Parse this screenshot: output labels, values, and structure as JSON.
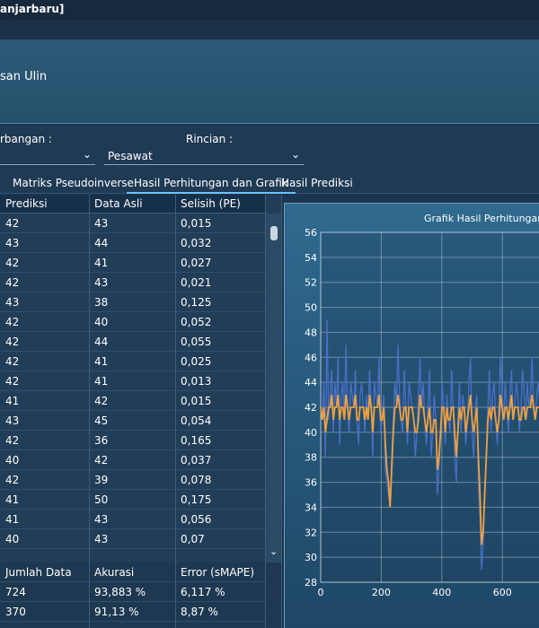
{
  "window": {
    "title": "anjarbaru]"
  },
  "header": {
    "title": "san Ulin"
  },
  "filters": {
    "left_label": "rbangan :",
    "right_label": "Rincian :",
    "right_value": "Pesawat"
  },
  "tabs": [
    "Matriks Pseudoinverse",
    "Hasil Perhitungan dan Grafik",
    "Hasil Prediksi"
  ],
  "grid": {
    "columns": [
      "Prediksi",
      "Data Asli",
      "Selisih (PE)"
    ],
    "rows": [
      [
        "42",
        "43",
        "0,015"
      ],
      [
        "43",
        "44",
        "0,032"
      ],
      [
        "42",
        "41",
        "0,027"
      ],
      [
        "42",
        "43",
        "0,021"
      ],
      [
        "43",
        "38",
        "0,125"
      ],
      [
        "42",
        "40",
        "0,052"
      ],
      [
        "42",
        "44",
        "0,055"
      ],
      [
        "42",
        "41",
        "0,025"
      ],
      [
        "42",
        "41",
        "0,013"
      ],
      [
        "41",
        "42",
        "0,015"
      ],
      [
        "43",
        "45",
        "0,054"
      ],
      [
        "42",
        "36",
        "0,165"
      ],
      [
        "40",
        "42",
        "0,037"
      ],
      [
        "42",
        "39",
        "0,078"
      ],
      [
        "41",
        "50",
        "0,175"
      ],
      [
        "41",
        "43",
        "0,056"
      ],
      [
        "40",
        "43",
        "0,07"
      ]
    ]
  },
  "summary": {
    "columns": [
      "Jumlah Data",
      "Akurasi",
      "Error (sMAPE)"
    ],
    "rows": [
      [
        "724",
        "93,883 %",
        "6,117 %"
      ],
      [
        "370",
        "91,13 %",
        "8,87 %"
      ]
    ]
  },
  "chart_data": {
    "type": "line",
    "title": "Grafik Hasil Perhitungan",
    "xlabel": "",
    "ylabel": "",
    "xlim": [
      0,
      724
    ],
    "ylim": [
      28,
      56
    ],
    "x_ticks": [
      0,
      200,
      400,
      600
    ],
    "y_ticks": [
      28,
      30,
      32,
      34,
      36,
      38,
      40,
      42,
      44,
      46,
      48,
      50,
      52,
      54,
      56
    ],
    "grid": true,
    "colors": {
      "actual": "#4a6fc7",
      "predicted": "#f0a040"
    },
    "series": [
      {
        "values": [
          42,
          41,
          44,
          38,
          49,
          41,
          43,
          45,
          40,
          44,
          42,
          46,
          39,
          43,
          44,
          41,
          47,
          42,
          40,
          44,
          43,
          42,
          45,
          41,
          39,
          43,
          44,
          42,
          40,
          43,
          41,
          45,
          42,
          38,
          44,
          43,
          42,
          46,
          40,
          41,
          43,
          37,
          36,
          35,
          34,
          38,
          41,
          44,
          42,
          47,
          43,
          41,
          40,
          45,
          42,
          39,
          44,
          43,
          42,
          41,
          38,
          40,
          43,
          46,
          42,
          44,
          41,
          39,
          42,
          45,
          38,
          40,
          43,
          41,
          35,
          37,
          40,
          44,
          42,
          39,
          43,
          41,
          40,
          45,
          42,
          38,
          36,
          41,
          44,
          40,
          43,
          42,
          39,
          41,
          44,
          46,
          40,
          38,
          42,
          43,
          36,
          33,
          29,
          31,
          35,
          38,
          42,
          45,
          40,
          43,
          44,
          41,
          39,
          42,
          46,
          43,
          41,
          44,
          42,
          40,
          43,
          45,
          41,
          42,
          44,
          43,
          40,
          42,
          45,
          43,
          41,
          44,
          42,
          43,
          46,
          42,
          41,
          43,
          44,
          42
        ]
      },
      {
        "values": [
          42,
          41,
          42,
          40,
          41,
          42,
          42,
          43,
          41,
          42,
          42,
          43,
          41,
          42,
          42,
          41,
          43,
          42,
          41,
          42,
          42,
          42,
          43,
          41,
          41,
          42,
          42,
          42,
          41,
          42,
          41,
          43,
          42,
          40,
          42,
          42,
          42,
          43,
          41,
          41,
          42,
          39,
          37,
          36,
          34,
          37,
          40,
          42,
          42,
          43,
          42,
          41,
          41,
          42,
          42,
          40,
          42,
          42,
          42,
          41,
          40,
          40,
          41,
          43,
          42,
          42,
          41,
          40,
          41,
          42,
          40,
          40,
          41,
          41,
          37,
          38,
          40,
          42,
          42,
          40,
          42,
          41,
          41,
          42,
          42,
          40,
          38,
          40,
          42,
          41,
          42,
          42,
          40,
          41,
          42,
          43,
          41,
          40,
          41,
          42,
          38,
          35,
          31,
          32,
          35,
          38,
          41,
          42,
          41,
          42,
          42,
          41,
          40,
          41,
          43,
          42,
          41,
          42,
          42,
          41,
          42,
          43,
          41,
          42,
          42,
          42,
          41,
          41,
          42,
          42,
          41,
          42,
          42,
          42,
          43,
          42,
          41,
          42,
          42,
          42
        ]
      }
    ]
  }
}
